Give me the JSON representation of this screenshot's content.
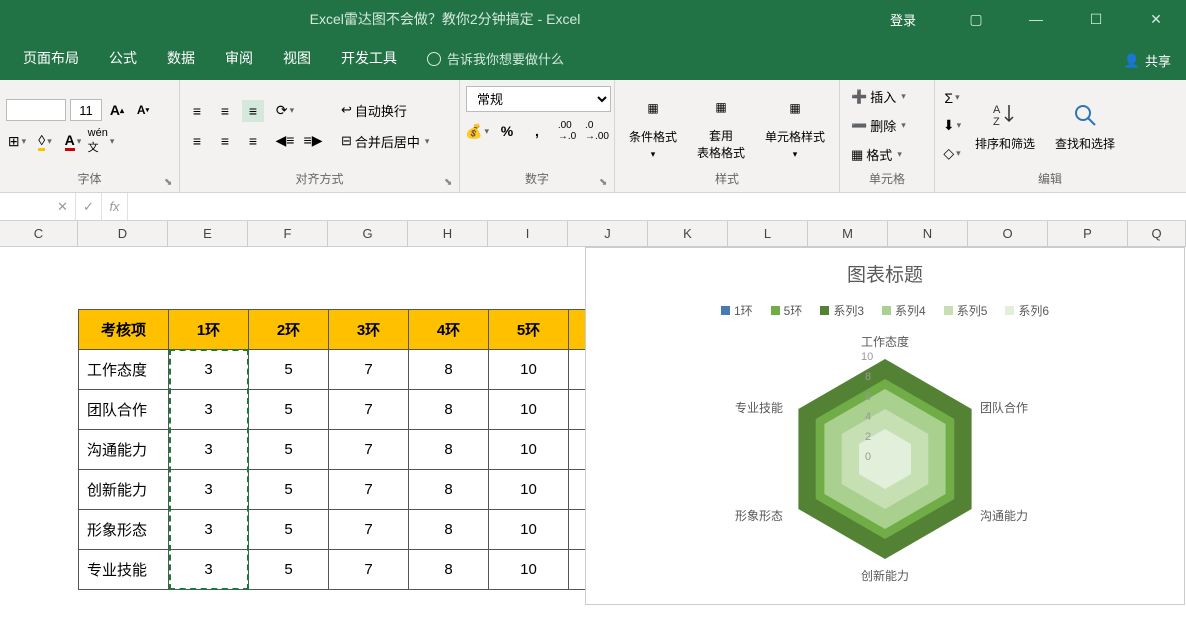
{
  "title": "Excel雷达图不会做？教你2分钟搞定  -  Excel",
  "login": "登录",
  "share": "共享",
  "tabs": [
    "页面布局",
    "公式",
    "数据",
    "审阅",
    "视图",
    "开发工具"
  ],
  "tell_me": "告诉我你想要做什么",
  "font": {
    "size": "11",
    "group_label": "字体"
  },
  "alignment": {
    "wrap": "自动换行",
    "merge": "合并后居中",
    "group_label": "对齐方式"
  },
  "number": {
    "format": "常规",
    "group_label": "数字"
  },
  "styles": {
    "conditional": "条件格式",
    "format_table": "套用\n表格格式",
    "cell_styles": "单元格样式",
    "group_label": "样式"
  },
  "cells": {
    "insert": "插入",
    "delete": "删除",
    "format": "格式",
    "group_label": "单元格"
  },
  "editing": {
    "sort": "排序和筛选",
    "find": "查找和选择",
    "group_label": "编辑"
  },
  "columns": [
    "C",
    "D",
    "E",
    "F",
    "G",
    "H",
    "I",
    "J",
    "K",
    "L",
    "M",
    "N",
    "O",
    "P",
    "Q"
  ],
  "table": {
    "headers": [
      "考核项",
      "1环",
      "2环",
      "3环",
      "4环",
      "5环"
    ],
    "rows": [
      [
        "工作态度",
        "3",
        "5",
        "7",
        "8",
        "10"
      ],
      [
        "团队合作",
        "3",
        "5",
        "7",
        "8",
        "10"
      ],
      [
        "沟通能力",
        "3",
        "5",
        "7",
        "8",
        "10"
      ],
      [
        "创新能力",
        "3",
        "5",
        "7",
        "8",
        "10"
      ],
      [
        "形象形态",
        "3",
        "5",
        "7",
        "8",
        "10"
      ],
      [
        "专业技能",
        "3",
        "5",
        "7",
        "8",
        "10"
      ]
    ]
  },
  "chart": {
    "title": "图表标题",
    "legend": [
      "1环",
      "5环",
      "系列3",
      "系列4",
      "系列5",
      "系列6"
    ],
    "legend_colors": [
      "#4a7ab5",
      "#70ad47",
      "#548235",
      "#a9d08e",
      "#c6e0b4",
      "#e2efda"
    ],
    "axes": [
      "工作态度",
      "团队合作",
      "沟通能力",
      "创新能力",
      "形象形态",
      "专业技能"
    ],
    "ticks": [
      "10",
      "8",
      "6",
      "4",
      "2",
      "0"
    ]
  },
  "chart_data": {
    "type": "radar",
    "title": "图表标题",
    "categories": [
      "工作态度",
      "团队合作",
      "沟通能力",
      "创新能力",
      "形象形态",
      "专业技能"
    ],
    "series": [
      {
        "name": "1环",
        "values": [
          3,
          3,
          3,
          3,
          3,
          3
        ]
      },
      {
        "name": "5环",
        "values": [
          5,
          5,
          5,
          5,
          5,
          5
        ]
      },
      {
        "name": "系列3",
        "values": [
          7,
          7,
          7,
          7,
          7,
          7
        ]
      },
      {
        "name": "系列4",
        "values": [
          8,
          8,
          8,
          8,
          8,
          8
        ]
      },
      {
        "name": "系列5",
        "values": [
          10,
          10,
          10,
          10,
          10,
          10
        ]
      },
      {
        "name": "系列6",
        "values": [
          10,
          10,
          10,
          10,
          10,
          10
        ]
      }
    ],
    "ylim": [
      0,
      10
    ]
  }
}
